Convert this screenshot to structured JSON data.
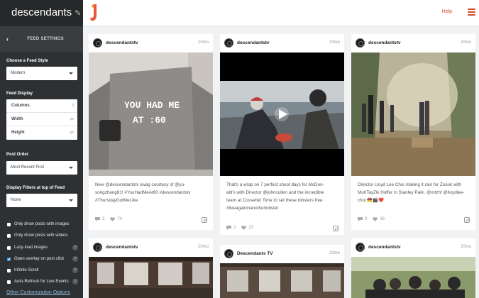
{
  "app": {
    "feed_name": "descendants",
    "help_label": "Help"
  },
  "sidebar": {
    "header": "FEED SETTINGS",
    "feed_style_label": "Choose a Feed Style",
    "feed_style_value": "Modern",
    "feed_display_label": "Feed Display",
    "fields": [
      {
        "label": "Columns",
        "unit": "3"
      },
      {
        "label": "Width",
        "unit": "px"
      },
      {
        "label": "Height",
        "unit": "px"
      }
    ],
    "post_order_label": "Post Order",
    "post_order_value": "Most Recent First",
    "filters_label": "Display Filters at top of Feed",
    "filters_value": "None",
    "options": [
      {
        "label": "Only show posts with images",
        "checked": false,
        "help": false
      },
      {
        "label": "Only show posts with videos",
        "checked": false,
        "help": false
      },
      {
        "label": "Lazy-load images",
        "checked": false,
        "help": true
      },
      {
        "label": "Open overlay on post click",
        "checked": true,
        "help": true
      },
      {
        "label": "Infinite Scroll",
        "checked": false,
        "help": true
      },
      {
        "label": "Auto-Refresh for Live Events",
        "checked": false,
        "help": true
      }
    ],
    "other_link": "Other Customization Options"
  },
  "posts": [
    {
      "user": "descendantstv",
      "time": "20mo",
      "caption": [
        "New @descendantstv swag courtesy of @yu-",
        "songzhang81! #YouHadMeAt60 #descendantstv",
        "#ThursdayGotMeLike"
      ],
      "comments": "3",
      "likes": "74",
      "shirt_text": [
        "YOU HAD ME",
        "AT :60"
      ]
    },
    {
      "user": "descendantstv",
      "time": "20mo",
      "caption": [
        "That's a wrap on 7 perfect shoot days for McDon-",
        "ald's with Director @johncullen and the incredible",
        "team at Cossette! Time to set these lobsters free",
        "#liveagaininanotherlobster"
      ],
      "comments": "2",
      "likes": "23"
    },
    {
      "user": "descendantstv",
      "time": "20mo",
      "caption": [
        "Director Lloyd Lee Choi making it rain for Zoosk with",
        "MuhTayZik Hoffer in Stanley Park. @mtzhf @lloydlee-",
        "choi 💏🎬❤️"
      ],
      "comments": "0",
      "likes": "36"
    },
    {
      "user": "descendantstv",
      "time": "20mo"
    },
    {
      "user": "Descendants TV",
      "time": "20mo"
    },
    {
      "user": "descendantstv",
      "time": "20mo"
    }
  ]
}
